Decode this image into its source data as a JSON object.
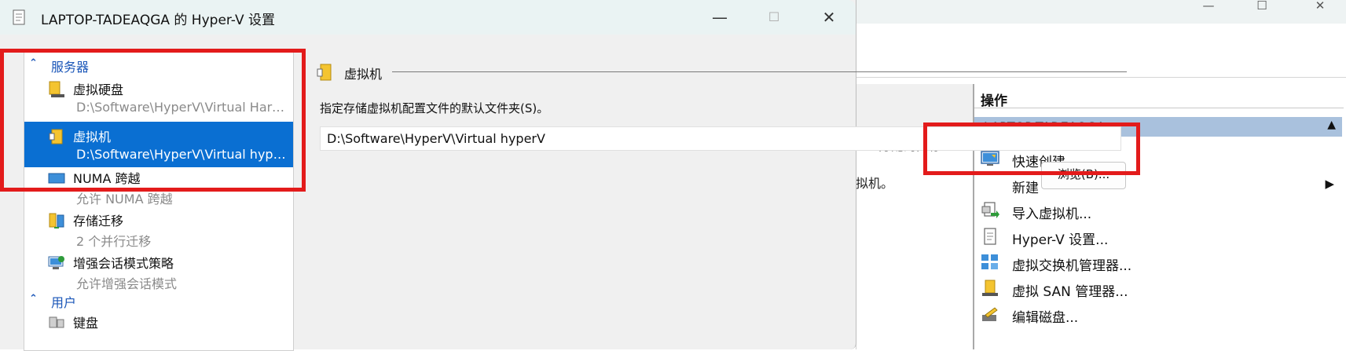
{
  "background_window": {
    "window_controls": [
      "—",
      "☐",
      "✕"
    ],
    "column_header": "分配的内存",
    "vm_text": "拟机。",
    "actions_pane": {
      "title": "操作",
      "host": "LAPTOP-TADEAQGA",
      "items": [
        {
          "label": "快速创建...",
          "icon": "quick-create-icon"
        },
        {
          "label": "新建",
          "icon": "",
          "submenu_arrow": "▶"
        },
        {
          "label": "导入虚拟机...",
          "icon": "import-vm-icon"
        },
        {
          "label": "Hyper-V 设置...",
          "icon": "settings-doc-icon"
        },
        {
          "label": "虚拟交换机管理器...",
          "icon": "virtual-switch-icon"
        },
        {
          "label": "虚拟 SAN 管理器...",
          "icon": "san-manager-icon"
        },
        {
          "label": "编辑磁盘...",
          "icon": "edit-disk-icon"
        }
      ]
    }
  },
  "dialog": {
    "title": "LAPTOP-TADEAQGA 的 Hyper-V 设置",
    "controls": {
      "minimize": "—",
      "maximize": "☐",
      "close": "✕"
    },
    "tree": {
      "server_header": "服务器",
      "items": [
        {
          "name": "虚拟硬盘",
          "sub": "D:\\Software\\HyperV\\Virtual Hard Disks",
          "icon": "virtual-disk-icon",
          "selected": false
        },
        {
          "name": "虚拟机",
          "sub": "D:\\Software\\HyperV\\Virtual hyperV",
          "icon": "virtual-machine-icon",
          "selected": true
        },
        {
          "name": "NUMA 跨越",
          "sub": "允许 NUMA 跨越",
          "icon": "numa-icon",
          "selected": false
        },
        {
          "name": "存储迁移",
          "sub": "2 个并行迁移",
          "icon": "storage-migration-icon",
          "selected": false
        },
        {
          "name": "增强会话模式策略",
          "sub": "允许增强会话模式",
          "icon": "enhanced-session-icon",
          "selected": false
        }
      ],
      "user_header": "用户",
      "user_items": [
        {
          "name": "键盘",
          "icon": "keyboard-icon"
        }
      ]
    },
    "panel": {
      "section_title": "虚拟机",
      "description": "指定存储虚拟机配置文件的默认文件夹(S)。",
      "path_value": "D:\\Software\\HyperV\\Virtual hyperV",
      "browse_label": "浏览(B)..."
    }
  },
  "colors": {
    "selection": "#0a6fd2",
    "header_blue": "#1a56b8",
    "host_bar": "#a9c1dd",
    "annotation_red": "#e31b1b"
  }
}
